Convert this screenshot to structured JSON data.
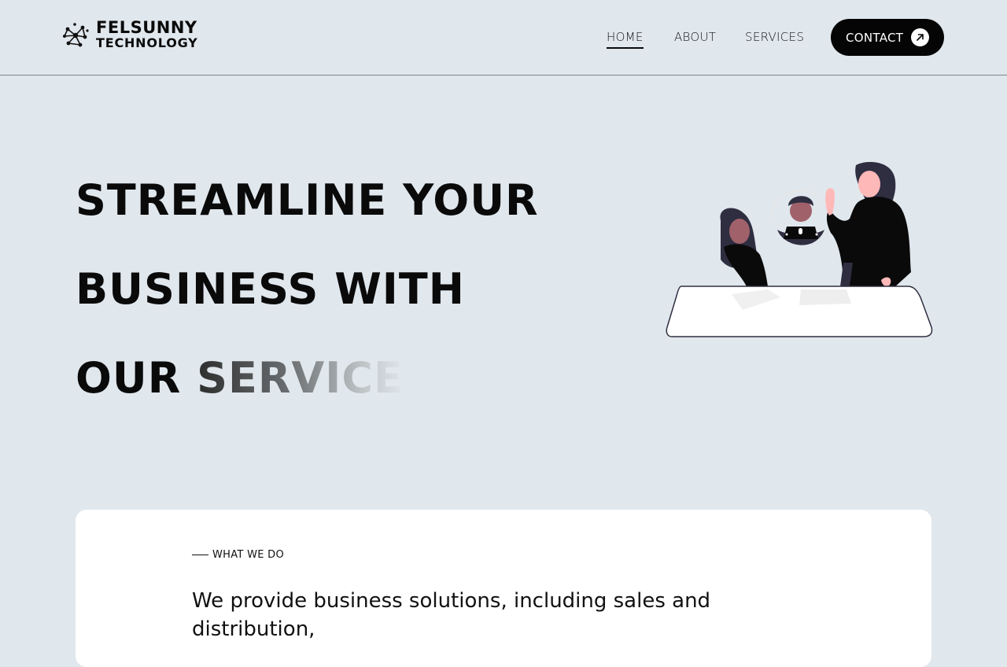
{
  "brand": {
    "line1": "FELSUNNY",
    "line2": "TECHNOLOGY"
  },
  "nav": {
    "home": "HOME",
    "about": "ABOUT",
    "services": "SERVICES",
    "contact": "CONTACT",
    "active": "HOME"
  },
  "hero": {
    "line1": "STREAMLINE YOUR",
    "line2": "BUSINESS WITH",
    "line3_static": "OUR ",
    "line3_typed": "SERVICE"
  },
  "what_we_do": {
    "eyebrow": "WHAT WE DO",
    "text": "We provide business solutions, including sales and distribution,"
  },
  "colors": {
    "background": "#e0e7ed",
    "accent": "#050505",
    "card": "#ffffff",
    "skin": "#a0616a",
    "shirt": "#111111"
  },
  "icons": {
    "logo": "network-nodes-icon",
    "contact": "arrow-up-right-icon"
  }
}
